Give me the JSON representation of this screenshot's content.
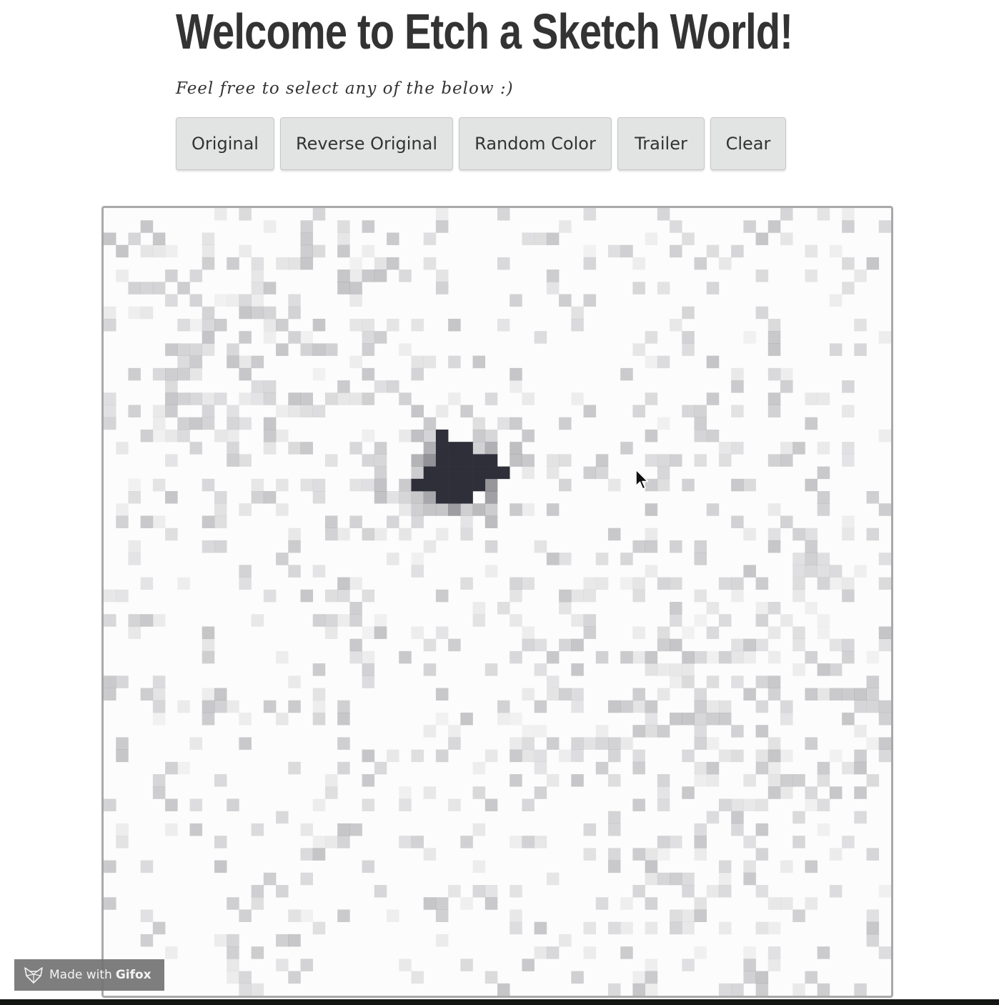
{
  "page": {
    "title": "Welcome to Etch a Sketch World!",
    "subtitle": "Feel free to select any of the below :)"
  },
  "toolbar": {
    "buttons": [
      {
        "label": "Original"
      },
      {
        "label": "Reverse Original"
      },
      {
        "label": "Random Color"
      },
      {
        "label": "Trailer"
      },
      {
        "label": "Clear"
      }
    ]
  },
  "sketch": {
    "grid_size": 64,
    "cell_color": "#2f2f3a",
    "background": "#fcfcfc"
  },
  "badge": {
    "prefix": "Made with",
    "brand": "Gifox"
  },
  "colors": {
    "button_bg": "#e2e3e3",
    "text": "#333333"
  }
}
